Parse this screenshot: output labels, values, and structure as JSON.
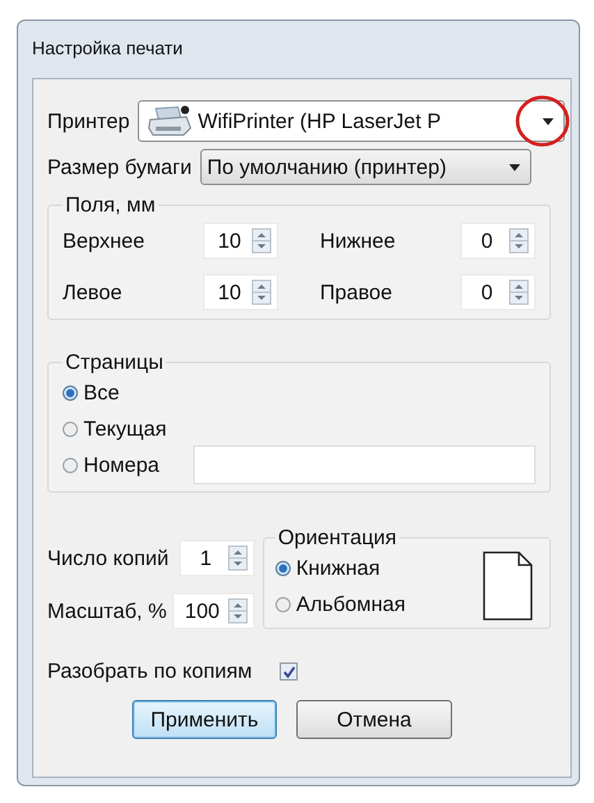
{
  "window": {
    "title": "Настройка печати"
  },
  "printer": {
    "label": "Принтер",
    "value": "WifiPrinter (HP LaserJet P"
  },
  "paper_size": {
    "label": "Размер бумаги",
    "value": "По умолчанию (принтер)"
  },
  "margins": {
    "title": "Поля, мм",
    "fields": [
      {
        "label": "Верхнее",
        "value": "10"
      },
      {
        "label": "Нижнее",
        "value": "0"
      },
      {
        "label": "Левое",
        "value": "10"
      },
      {
        "label": "Правое",
        "value": "0"
      }
    ]
  },
  "pages": {
    "title": "Страницы",
    "options": [
      {
        "label": "Все",
        "selected": true
      },
      {
        "label": "Текущая",
        "selected": false
      },
      {
        "label": "Номера",
        "selected": false
      }
    ]
  },
  "copies": {
    "label": "Число копий",
    "value": "1"
  },
  "scale": {
    "label": "Масштаб, %",
    "value": "100"
  },
  "orientation": {
    "title": "Ориентация",
    "options": [
      {
        "label": "Книжная",
        "selected": true
      },
      {
        "label": "Альбомная",
        "selected": false
      }
    ]
  },
  "collate": {
    "label": "Разобрать по копиям",
    "checked": true
  },
  "buttons": [
    {
      "label": "Применить",
      "default": true
    },
    {
      "label": "Отмена",
      "default": false
    }
  ]
}
